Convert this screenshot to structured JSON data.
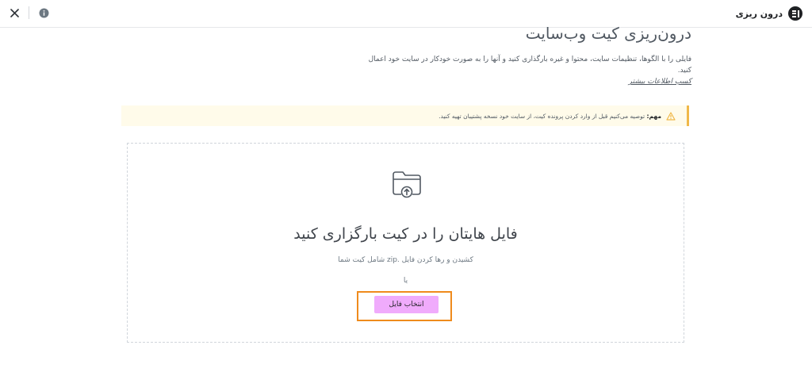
{
  "header": {
    "app_title": "درون ریزی",
    "close_label": "✕",
    "info_label": "i"
  },
  "page": {
    "title": "درون‌ریزی کیت وب‌سایت",
    "description": "فایلی را با الگوها، تنظیمات سایت، محتوا و غیره بارگذاری کنید و آنها را به صورت خودکار در سایت خود اعمال کنید.",
    "learn_more": "کسب اطلاعات بیشتر"
  },
  "notice": {
    "label": "مهم:",
    "text": " توصیه می‌کنیم قبل از وارد کردن پرونده کیت، از سایت خود نسخه پشتیبان تهیه کنید."
  },
  "dropzone": {
    "title": "فایل هایتان را در کیت بارگزاری کنید",
    "subtitle": "کشیدن و رها کردن فایل .zip شامل کیت شما",
    "or_label": "یا",
    "button_label": "انتخاب فایل"
  },
  "colors": {
    "accent_button": "#f0abfc",
    "highlight_border": "#ef8b1d",
    "notice_bg": "#fffbea",
    "notice_border": "#f0b849",
    "text": "#515962"
  },
  "icons": {
    "brand": "elementor-logo-icon",
    "close": "close-icon",
    "info": "info-icon",
    "warning": "warning-icon",
    "upload": "folder-upload-icon"
  }
}
